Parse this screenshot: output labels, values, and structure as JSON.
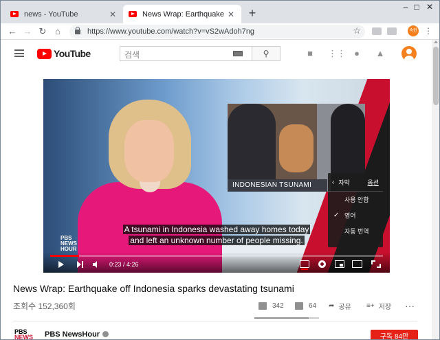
{
  "browser": {
    "tabs": [
      {
        "label": "news - YouTube",
        "active": false
      },
      {
        "label": "News Wrap: Earthquake off Indo",
        "active": true
      }
    ],
    "new_tab": "+",
    "window_controls": {
      "minimize": "–",
      "maximize": "□",
      "close": "✕"
    },
    "url": "https://www.youtube.com/watch?v=vS2wAdoh7ng",
    "profile_initials": "숙현"
  },
  "youtube": {
    "logo_text": "YouTube",
    "search_placeholder": "검색",
    "colors": {
      "brand_red": "#ff0000",
      "subscribe_red": "#e62117",
      "avatar_orange": "#f4801e"
    }
  },
  "player": {
    "lower_third": "INDONESIAN TSUNAMI",
    "caption_line1": "A tsunami in Indonesia washed away homes today",
    "caption_line2": "and left an unknown number of people missing.",
    "pbs_bug_line1": "PBS",
    "pbs_bug_line2": "NEWS",
    "pbs_bug_line3": "HOUR",
    "time_current": "0:23",
    "time_sep": " / ",
    "time_total": "4:26",
    "progress_fraction": 0.086,
    "subtitle_menu": {
      "header": "자막",
      "options_link": "옵션",
      "items": [
        {
          "label": "사용 안함",
          "checked": false
        },
        {
          "label": "영어",
          "checked": true
        },
        {
          "label": "자동 번역",
          "checked": false
        }
      ],
      "check_glyph": "✓"
    }
  },
  "video": {
    "title": "News Wrap: Earthquake off Indonesia sparks devastating tsunami",
    "views": "조회수 152,360회",
    "likes": "342",
    "dislikes": "64",
    "share": "공유",
    "save": "저장",
    "like_fraction": 0.84,
    "channel_logo_line1": "PBS",
    "channel_logo_line2": "NEWS",
    "channel_name": "PBS NewsHour",
    "subscribe_label": "구독 84만"
  }
}
